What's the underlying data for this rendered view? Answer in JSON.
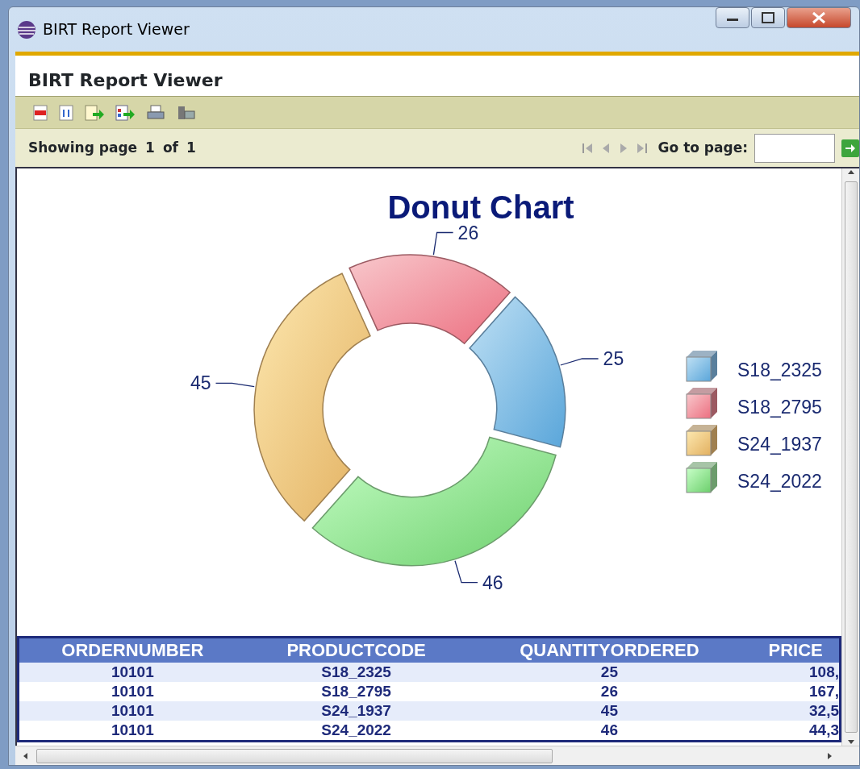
{
  "window": {
    "title": "BIRT Report Viewer"
  },
  "app_title": "BIRT Report Viewer",
  "navigation": {
    "showing": "Showing page",
    "page": "1",
    "of": "of",
    "total": "1",
    "goto_label": "Go to page:"
  },
  "chart_data": {
    "type": "donut",
    "title": "Donut Chart",
    "categories": [
      "S18_2325",
      "S18_2795",
      "S24_1937",
      "S24_2022"
    ],
    "values": [
      25,
      26,
      45,
      46
    ],
    "data_labels": true,
    "legend": "right"
  },
  "table": {
    "columns": [
      "ORDERNUMBER",
      "PRODUCTCODE",
      "QUANTITYORDERED",
      "PRICE"
    ],
    "rows": [
      [
        "10101",
        "S18_2325",
        "25",
        "108,"
      ],
      [
        "10101",
        "S18_2795",
        "26",
        "167,"
      ],
      [
        "10101",
        "S24_1937",
        "45",
        "32,5"
      ],
      [
        "10101",
        "S24_2022",
        "46",
        "44,3"
      ]
    ]
  }
}
